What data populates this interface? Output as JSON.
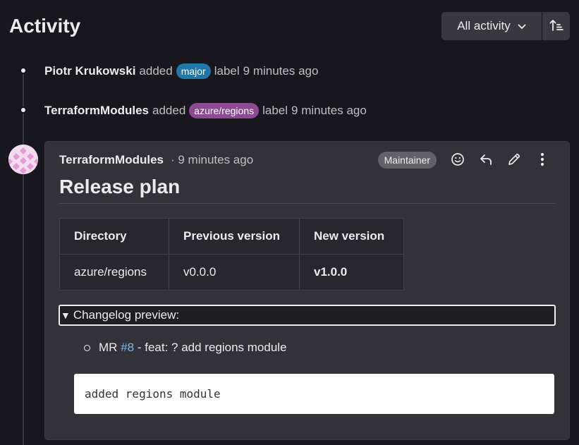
{
  "page": {
    "title": "Activity"
  },
  "filter": {
    "label": "All activity"
  },
  "events": [
    {
      "author": "Piotr Krukowski",
      "action": "added",
      "label": "major",
      "label_color": "#1f78a8",
      "suffix": "label",
      "time": "9 minutes ago"
    },
    {
      "author": "TerraformModules",
      "action": "added",
      "label": "azure/regions",
      "label_color": "#8b4a91",
      "suffix": "label",
      "time": "9 minutes ago"
    }
  ],
  "note": {
    "author": "TerraformModules",
    "time": "· 9 minutes ago",
    "role": "Maintainer",
    "title": "Release plan",
    "table": {
      "headers": [
        "Directory",
        "Previous version",
        "New version"
      ],
      "rows": [
        [
          "azure/regions",
          "v0.0.0",
          "v1.0.0"
        ]
      ]
    },
    "details_summary": "Changelog preview:",
    "changelog": {
      "prefix": "MR",
      "link": "#8",
      "text": "- feat: ? add regions module"
    },
    "code": "added regions module"
  },
  "icons": {
    "dropdown": "chevron-down-icon",
    "sort": "sort-ascending-icon",
    "emoji": "smiley-icon",
    "reply": "reply-icon",
    "edit": "pencil-icon",
    "more": "more-vertical-icon"
  }
}
